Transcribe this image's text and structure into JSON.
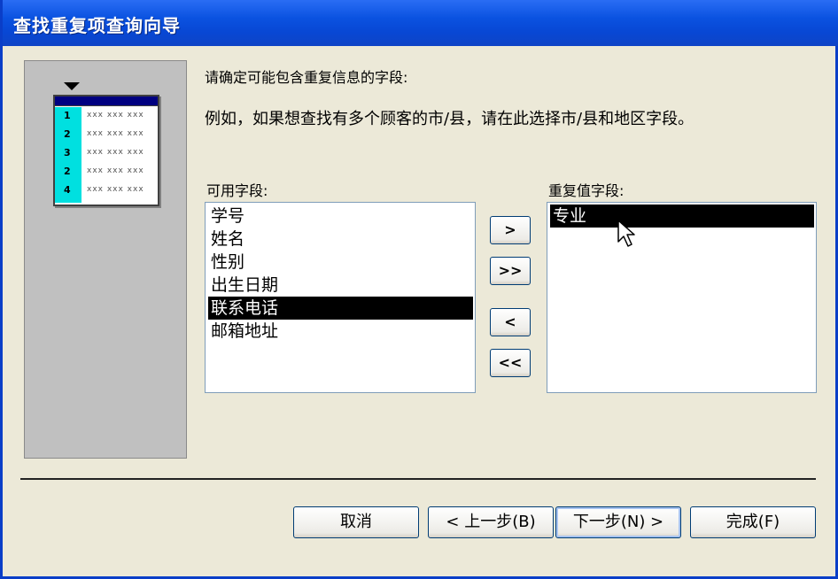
{
  "window": {
    "title": "查找重复项查询向导",
    "title_color": "#0a52e0"
  },
  "preview": {
    "row_numbers": [
      "1",
      "2",
      "3",
      "2",
      "4"
    ],
    "cell_text": "xxx xxx xxx"
  },
  "instructions": {
    "line1": "请确定可能包含重复信息的字段:",
    "line2": "例如，如果想查找有多个顾客的市/县，请在此选择市/县和地区字段。"
  },
  "available": {
    "label": "可用字段:",
    "items": [
      "学号",
      "姓名",
      "性别",
      "出生日期",
      "联系电话",
      "邮箱地址"
    ],
    "selected": "联系电话"
  },
  "duplicate": {
    "label": "重复值字段:",
    "items": [
      "专业"
    ],
    "selected": "专业"
  },
  "move_buttons": {
    "add": ">",
    "add_all": ">>",
    "remove": "<",
    "remove_all": "<<"
  },
  "footer": {
    "cancel": "取消",
    "back": "< 上一步(B)",
    "next": "下一步(N) >",
    "finish": "完成(F)"
  }
}
